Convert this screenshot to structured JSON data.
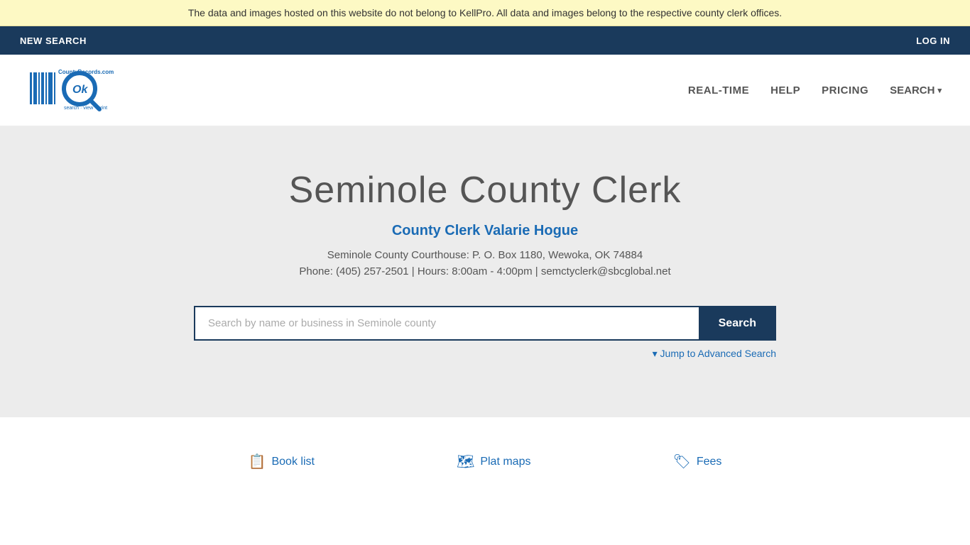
{
  "banner": {
    "text": "The data and images hosted on this website do not belong to KellPro. All data and images belong to the respective county clerk offices."
  },
  "navbar": {
    "new_search_label": "NEW SEARCH",
    "login_label": "LOG IN"
  },
  "header": {
    "logo_alt": "OKCountyRecords.com",
    "logo_tagline": "search · view · print",
    "nav_items": [
      {
        "label": "REAL-TIME",
        "href": "#"
      },
      {
        "label": "HELP",
        "href": "#"
      },
      {
        "label": "PRICING",
        "href": "#"
      },
      {
        "label": "SEARCH",
        "href": "#"
      }
    ]
  },
  "hero": {
    "title": "Seminole County Clerk",
    "subtitle": "County Clerk Valarie Hogue",
    "address": "Seminole County Courthouse: P. O. Box 1180, Wewoka, OK 74884",
    "contact": "Phone: (405) 257-2501 | Hours: 8:00am - 4:00pm | semctyclerk@sbcglobal.net",
    "search_placeholder": "Search by name or business in Seminole county",
    "search_button_label": "Search",
    "advanced_search_label": "▾ Jump to Advanced Search"
  },
  "footer_links": [
    {
      "icon": "📋",
      "label": "Book list",
      "href": "#"
    },
    {
      "icon": "🗺",
      "label": "Plat maps",
      "href": "#"
    },
    {
      "icon": "🏷",
      "label": "Fees",
      "href": "#"
    }
  ],
  "colors": {
    "dark_blue": "#1a3a5c",
    "link_blue": "#1a6bb5",
    "banner_bg": "#fdf9c4",
    "hero_bg": "#ececec"
  }
}
